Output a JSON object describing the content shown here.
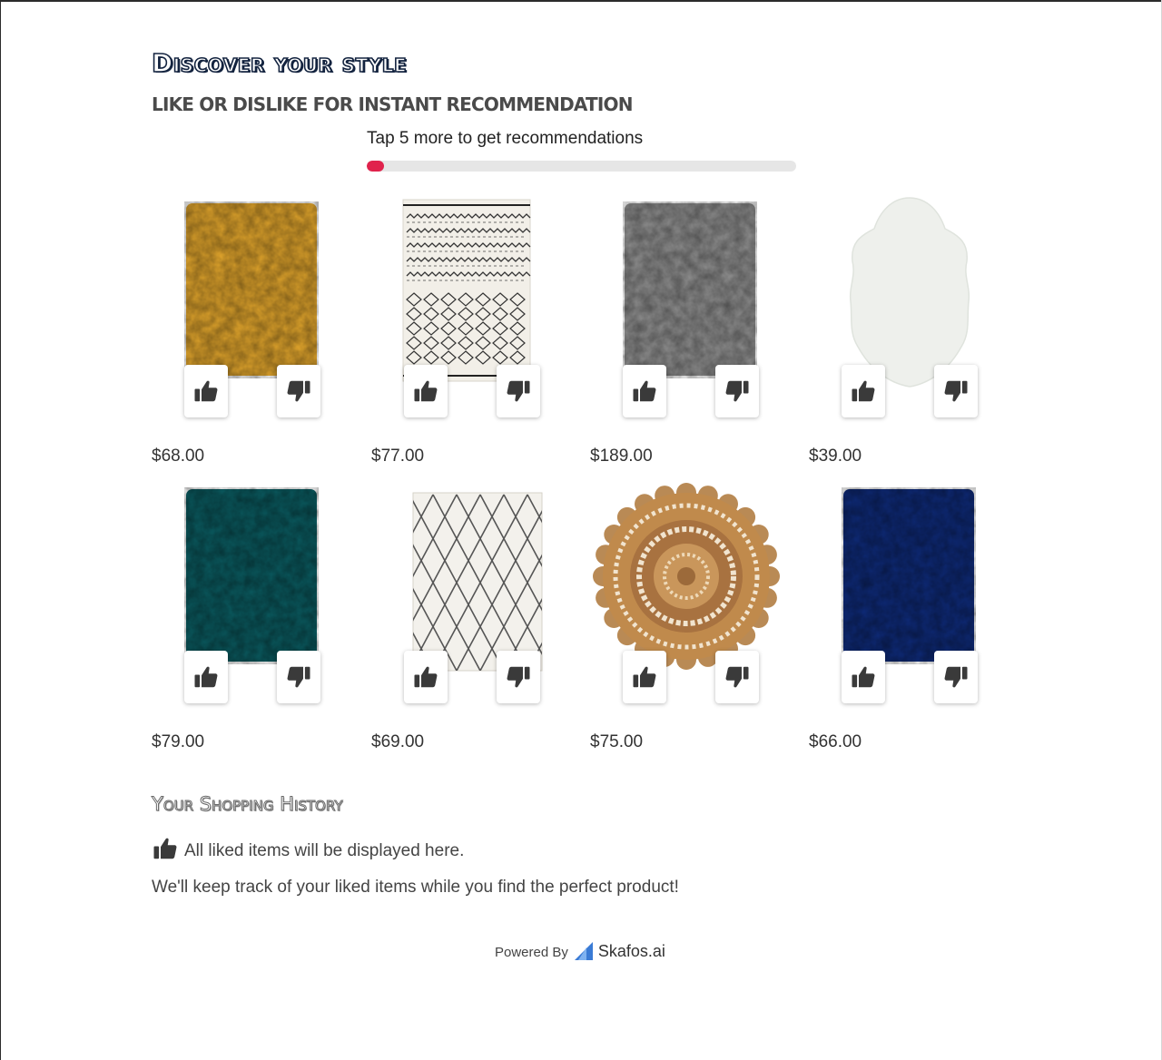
{
  "header": {
    "title": "Discover your style",
    "subtitle": "LIKE OR DISLIKE FOR INSTANT RECOMMENDATION"
  },
  "progress": {
    "text": "Tap 5 more to get recommendations",
    "fraction": 0.04,
    "fill_color": "#e0224c"
  },
  "products": [
    {
      "price": "$68.00",
      "style": "shag",
      "color": "#e1a52c",
      "like_icon": "thumbs-up-icon",
      "dislike_icon": "thumbs-down-icon"
    },
    {
      "price": "$77.00",
      "style": "berber-patterned",
      "color": "#f2efe8",
      "like_icon": "thumbs-up-icon",
      "dislike_icon": "thumbs-down-icon"
    },
    {
      "price": "$189.00",
      "style": "shag",
      "color": "#8f8f8f",
      "like_icon": "thumbs-up-icon",
      "dislike_icon": "thumbs-down-icon"
    },
    {
      "price": "$39.00",
      "style": "sheepskin",
      "color": "#eef0ec",
      "like_icon": "thumbs-up-icon",
      "dislike_icon": "thumbs-down-icon"
    },
    {
      "price": "$79.00",
      "style": "shag",
      "color": "#0a5a5f",
      "like_icon": "thumbs-up-icon",
      "dislike_icon": "thumbs-down-icon"
    },
    {
      "price": "$69.00",
      "style": "diamond-trellis",
      "color": "#f3f1ec",
      "like_icon": "thumbs-up-icon",
      "dislike_icon": "thumbs-down-icon"
    },
    {
      "price": "$75.00",
      "style": "round-jute",
      "color": "#c08a4c",
      "like_icon": "thumbs-up-icon",
      "dislike_icon": "thumbs-down-icon"
    },
    {
      "price": "$66.00",
      "style": "shag",
      "color": "#0e2a78",
      "like_icon": "thumbs-up-icon",
      "dislike_icon": "thumbs-down-icon"
    }
  ],
  "history": {
    "title": "Your Shopping History",
    "icon": "thumbs-up-icon",
    "line1": "All liked items will be displayed here.",
    "line2": "We'll keep track of your liked items while you find the perfect product!"
  },
  "footer": {
    "powered_by": "Powered By",
    "brand": "Skafos.ai",
    "logo_icon": "skafos-logo-icon",
    "logo_colors": [
      "#3a7bd5",
      "#7fb2f0"
    ]
  }
}
